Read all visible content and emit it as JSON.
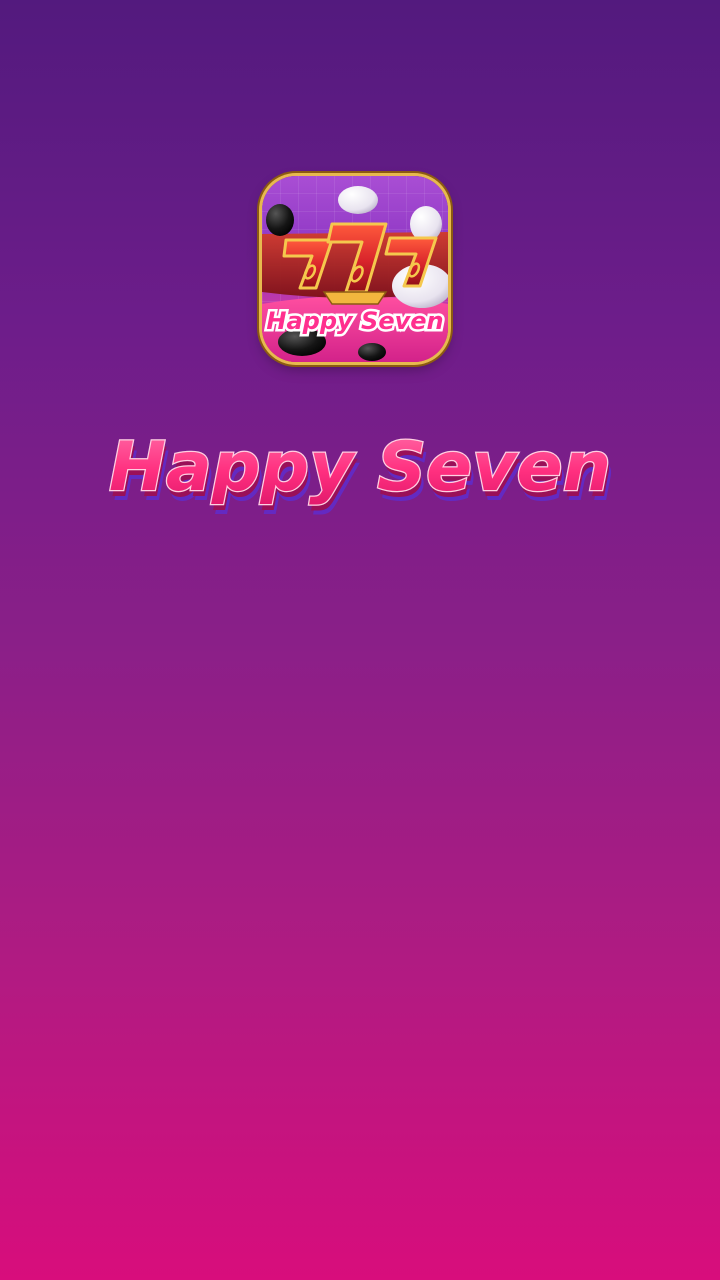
{
  "app": {
    "icon_label": "Happy Seven",
    "icon_symbol": "777",
    "title": "Happy Seven"
  },
  "colors": {
    "background_top": "#531a7e",
    "background_bottom": "#d80d7c",
    "title_pink": "#ff3f86",
    "title_outline": "#ffd0e2",
    "icon_gold": "#e7b94f",
    "seven_red": "#d8242b"
  }
}
